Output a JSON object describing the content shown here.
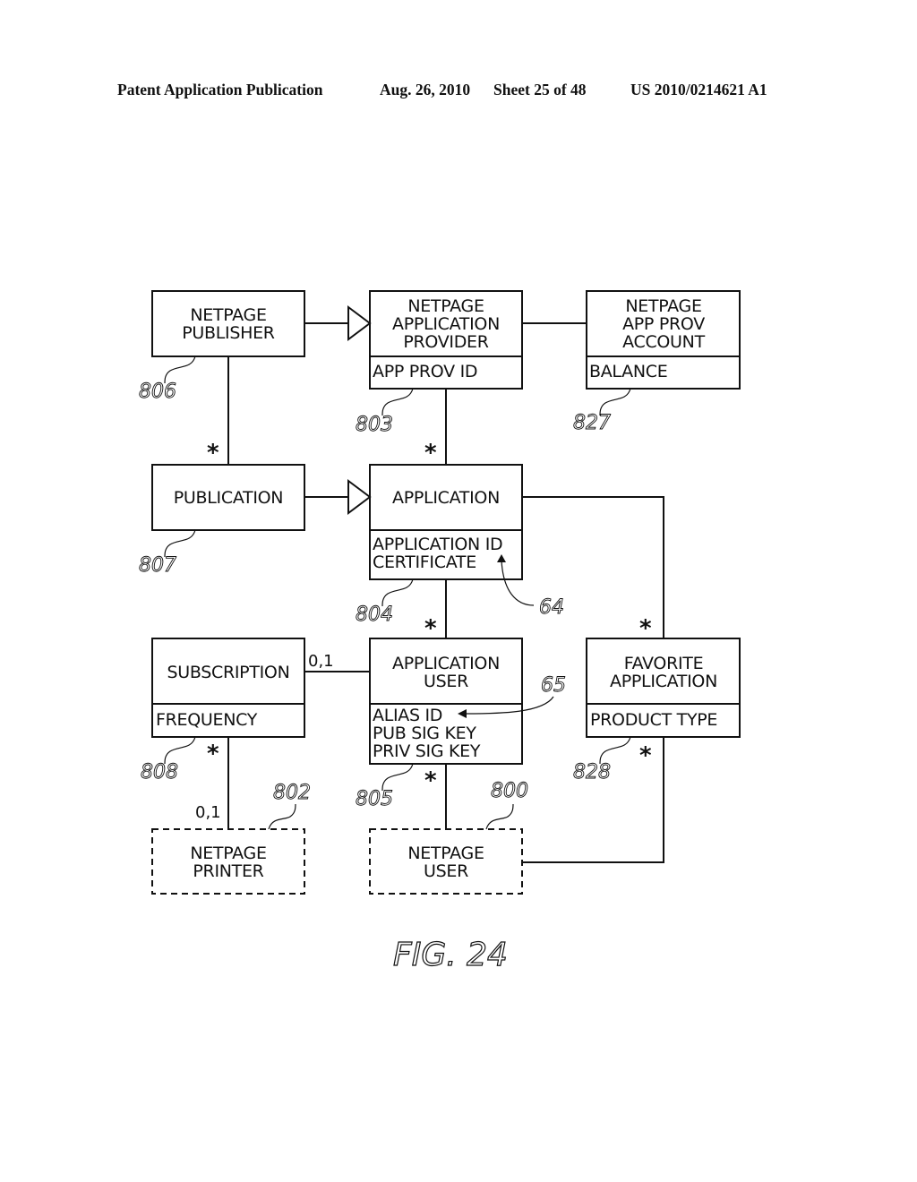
{
  "header": {
    "publication": "Patent Application Publication",
    "date": "Aug. 26, 2010",
    "sheet": "Sheet 25 of 48",
    "number": "US 2010/0214621 A1"
  },
  "figure_label": "FIG. 24",
  "classes": {
    "publisher": {
      "name": [
        "NETPAGE",
        "PUBLISHER"
      ],
      "ref": "806"
    },
    "app_provider": {
      "name": [
        "NETPAGE",
        "APPLICATION",
        "PROVIDER"
      ],
      "attributes": [
        "APP PROV ID"
      ],
      "ref": "803"
    },
    "app_prov_account": {
      "name": [
        "NETPAGE",
        "APP PROV",
        "ACCOUNT"
      ],
      "attributes": [
        "BALANCE"
      ],
      "ref": "827"
    },
    "publication": {
      "name": [
        "PUBLICATION"
      ],
      "ref": "807"
    },
    "application": {
      "name": [
        "APPLICATION"
      ],
      "attributes": [
        "APPLICATION ID",
        "CERTIFICATE"
      ],
      "ref": "804"
    },
    "subscription": {
      "name": [
        "SUBSCRIPTION"
      ],
      "attributes": [
        "FREQUENCY"
      ],
      "ref": "808"
    },
    "application_user": {
      "name": [
        "APPLICATION",
        "USER"
      ],
      "attributes": [
        "ALIAS ID",
        "PUB SIG KEY",
        "PRIV SIG KEY"
      ],
      "ref": "805"
    },
    "favorite_application": {
      "name": [
        "FAVORITE",
        "APPLICATION"
      ],
      "attributes": [
        "PRODUCT TYPE"
      ],
      "ref": "828"
    },
    "printer": {
      "name": [
        "NETPAGE",
        "PRINTER"
      ],
      "ref": "802"
    },
    "user": {
      "name": [
        "NETPAGE",
        "USER"
      ],
      "ref": "800"
    }
  },
  "callouts": {
    "certificate": "64",
    "alias_id": "65"
  },
  "multiplicities": {
    "many": "*",
    "zero_or_one": "0,1"
  }
}
